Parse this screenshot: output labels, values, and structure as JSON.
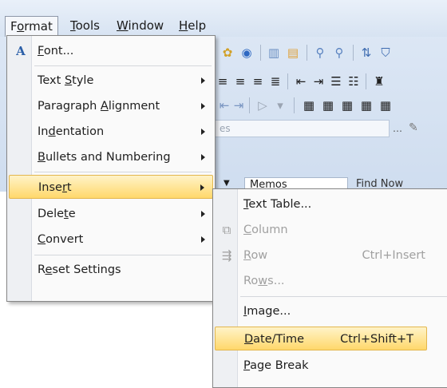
{
  "menubar": [
    {
      "label": "Format",
      "accel": "o",
      "open": true
    },
    {
      "label": "Tools",
      "accel": "T"
    },
    {
      "label": "Window",
      "accel": "W"
    },
    {
      "label": "Help",
      "accel": "H"
    }
  ],
  "format_menu": {
    "items": [
      {
        "label": "Font...",
        "icon": "font-icon",
        "submenu": false
      },
      {
        "label": "Text Style",
        "submenu": true
      },
      {
        "label": "Paragraph Alignment",
        "submenu": true
      },
      {
        "label": "Indentation",
        "submenu": true
      },
      {
        "label": "Bullets and Numbering",
        "submenu": true
      },
      {
        "label": "Insert",
        "submenu": true,
        "highlighted": true
      },
      {
        "label": "Delete",
        "submenu": true
      },
      {
        "label": "Convert",
        "submenu": true
      },
      {
        "label": "Reset Settings",
        "submenu": false
      }
    ]
  },
  "insert_submenu": {
    "items": [
      {
        "label": "Text Table...",
        "shortcut": "",
        "enabled": true
      },
      {
        "label": "Column",
        "shortcut": "",
        "enabled": false,
        "icon": "insert-column-icon"
      },
      {
        "label": "Row",
        "shortcut": "Ctrl+Insert",
        "enabled": false,
        "icon": "insert-row-icon"
      },
      {
        "label": "Rows...",
        "shortcut": "",
        "enabled": false
      },
      {
        "label": "Image...",
        "shortcut": "",
        "enabled": true
      },
      {
        "label": "Date/Time",
        "shortcut": "Ctrl+Shift+T",
        "enabled": true,
        "highlighted": true
      },
      {
        "label": "Page Break",
        "shortcut": "",
        "enabled": true
      }
    ]
  },
  "background": {
    "memo_field": "Memos",
    "find_now": "Find Now",
    "style_combo_placeholder": "es"
  },
  "colors": {
    "highlight_top": "#fff3c8",
    "highlight_bottom": "#ffd86b",
    "menu_bg": "#fafafa",
    "ribbon": "#d7e3f2"
  }
}
